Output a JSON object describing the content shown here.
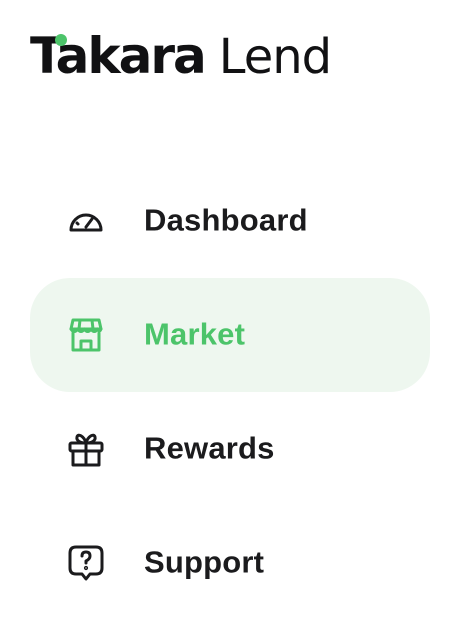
{
  "app": {
    "brand_name": "Takara",
    "product_name": "Lend"
  },
  "theme": {
    "accent": "#4cc46a",
    "active_bg": "#eef7ef",
    "text": "#1b1b1d"
  },
  "nav": {
    "items": [
      {
        "label": "Dashboard",
        "icon": "gauge-icon",
        "active": false
      },
      {
        "label": "Market",
        "icon": "storefront-icon",
        "active": true
      },
      {
        "label": "Rewards",
        "icon": "gift-icon",
        "active": false
      },
      {
        "label": "Support",
        "icon": "question-bubble-icon",
        "active": false
      }
    ]
  }
}
